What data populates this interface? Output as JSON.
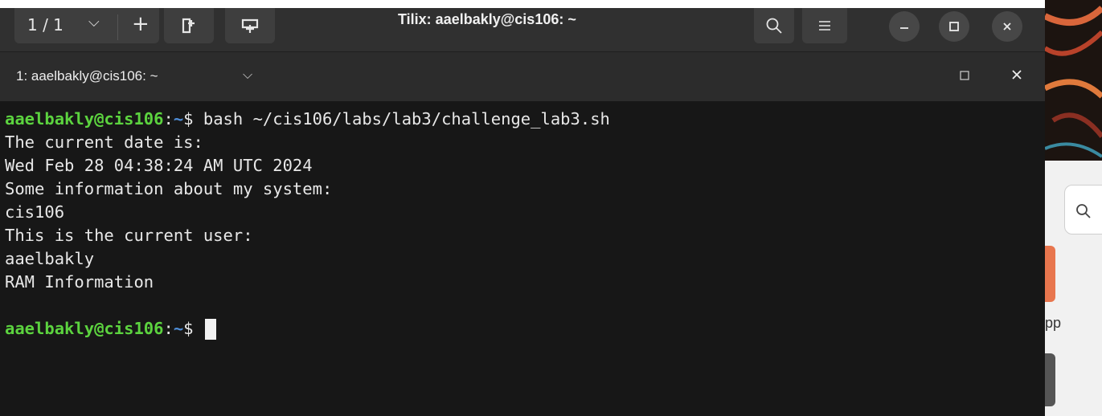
{
  "window": {
    "title": "Tilix: aaelbakly@cis106: ~",
    "session_count": "1 / 1",
    "terminal_title": "1: aaelbakly@cis106: ~"
  },
  "icons": {
    "chevron": "chevron-down-icon",
    "plus": "plus-icon",
    "search": "search-icon",
    "menu": "hamburger-menu-icon",
    "minimize": "minimize-icon",
    "maximize": "maximize-icon",
    "close": "close-icon"
  },
  "terminal": {
    "prompt_user": "aaelbakly@cis106",
    "prompt_sep": ":",
    "prompt_path": "~",
    "prompt_symbol": "$ ",
    "command": "bash ~/cis106/labs/lab3/challenge_lab3.sh",
    "output": [
      "The current date is:",
      "Wed Feb 28 04:38:24 AM UTC 2024",
      "Some information about my system:",
      "cis106",
      "This is the current user:",
      "aaelbakly",
      "RAM Information",
      ""
    ]
  },
  "background_app": {
    "partial_text": "pp"
  },
  "colors": {
    "prompt_user": "#5cd33f",
    "prompt_path": "#4f8ed8",
    "terminal_bg": "#171717",
    "titlebar_bg": "#303030"
  }
}
